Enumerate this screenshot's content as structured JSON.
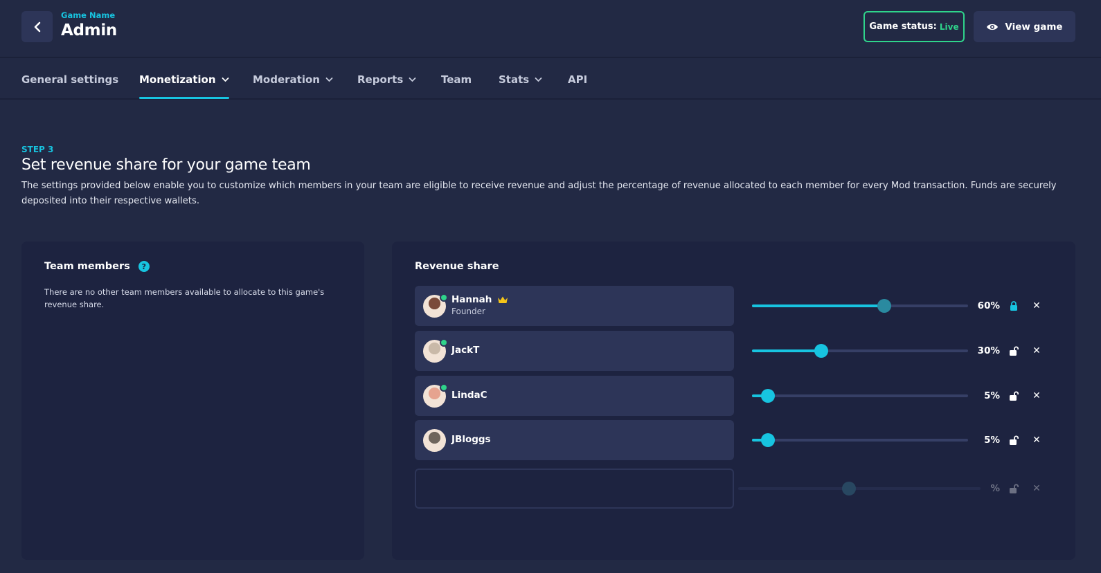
{
  "header": {
    "game_name": "Game Name",
    "title": "Admin",
    "status_label": "Game status:",
    "status_value": "Live",
    "view_game_label": "View game"
  },
  "tabs": [
    {
      "label": "General settings",
      "dropdown": false,
      "active": false
    },
    {
      "label": "Monetization",
      "dropdown": true,
      "active": true
    },
    {
      "label": "Moderation",
      "dropdown": true,
      "active": false
    },
    {
      "label": "Reports",
      "dropdown": true,
      "active": false
    },
    {
      "label": "Team",
      "dropdown": false,
      "active": false
    },
    {
      "label": "Stats",
      "dropdown": true,
      "active": false
    },
    {
      "label": "API",
      "dropdown": false,
      "active": false
    }
  ],
  "intro": {
    "step": "STEP 3",
    "heading": "Set revenue share for your game team",
    "description": "The settings provided below enable you to customize which members in your team are eligible to receive revenue and adjust the percentage of revenue allocated to each member for every Mod transaction. Funds are securely deposited into their respective wallets."
  },
  "team_panel": {
    "title": "Team members",
    "empty_message": "There are no other team members available to allocate to this game's revenue share."
  },
  "revenue_panel": {
    "title": "Revenue share",
    "members": [
      {
        "name": "Hannah",
        "role": "Founder",
        "crown": true,
        "online": true,
        "percent_label": "60%",
        "share": 0.6,
        "locked": true,
        "avatar_color": "#7a4a3a"
      },
      {
        "name": "JackT",
        "role": "",
        "crown": false,
        "online": true,
        "percent_label": "30%",
        "share": 0.3,
        "locked": false,
        "avatar_color": "#c9b9a8"
      },
      {
        "name": "LindaC",
        "role": "",
        "crown": false,
        "online": true,
        "percent_label": "5%",
        "share": 0.05,
        "locked": false,
        "avatar_color": "#e6a38f"
      },
      {
        "name": "JBloggs",
        "role": "",
        "crown": false,
        "online": false,
        "percent_label": "5%",
        "share": 0.05,
        "locked": false,
        "avatar_color": "#6f655c"
      }
    ],
    "empty_row": {
      "percent_label": "%",
      "share": 0.5
    }
  },
  "colors": {
    "accent": "#17c4e0",
    "live": "#2fd48b",
    "background": "#222944",
    "panel": "#1d2340",
    "card": "#2d3558"
  },
  "icons": {
    "back": "chevron-left-icon",
    "view": "eye-icon",
    "help": "question-circle-icon",
    "crown": "crown-icon",
    "locked": "lock-closed-icon",
    "unlocked": "lock-open-icon",
    "remove": "close-icon"
  }
}
